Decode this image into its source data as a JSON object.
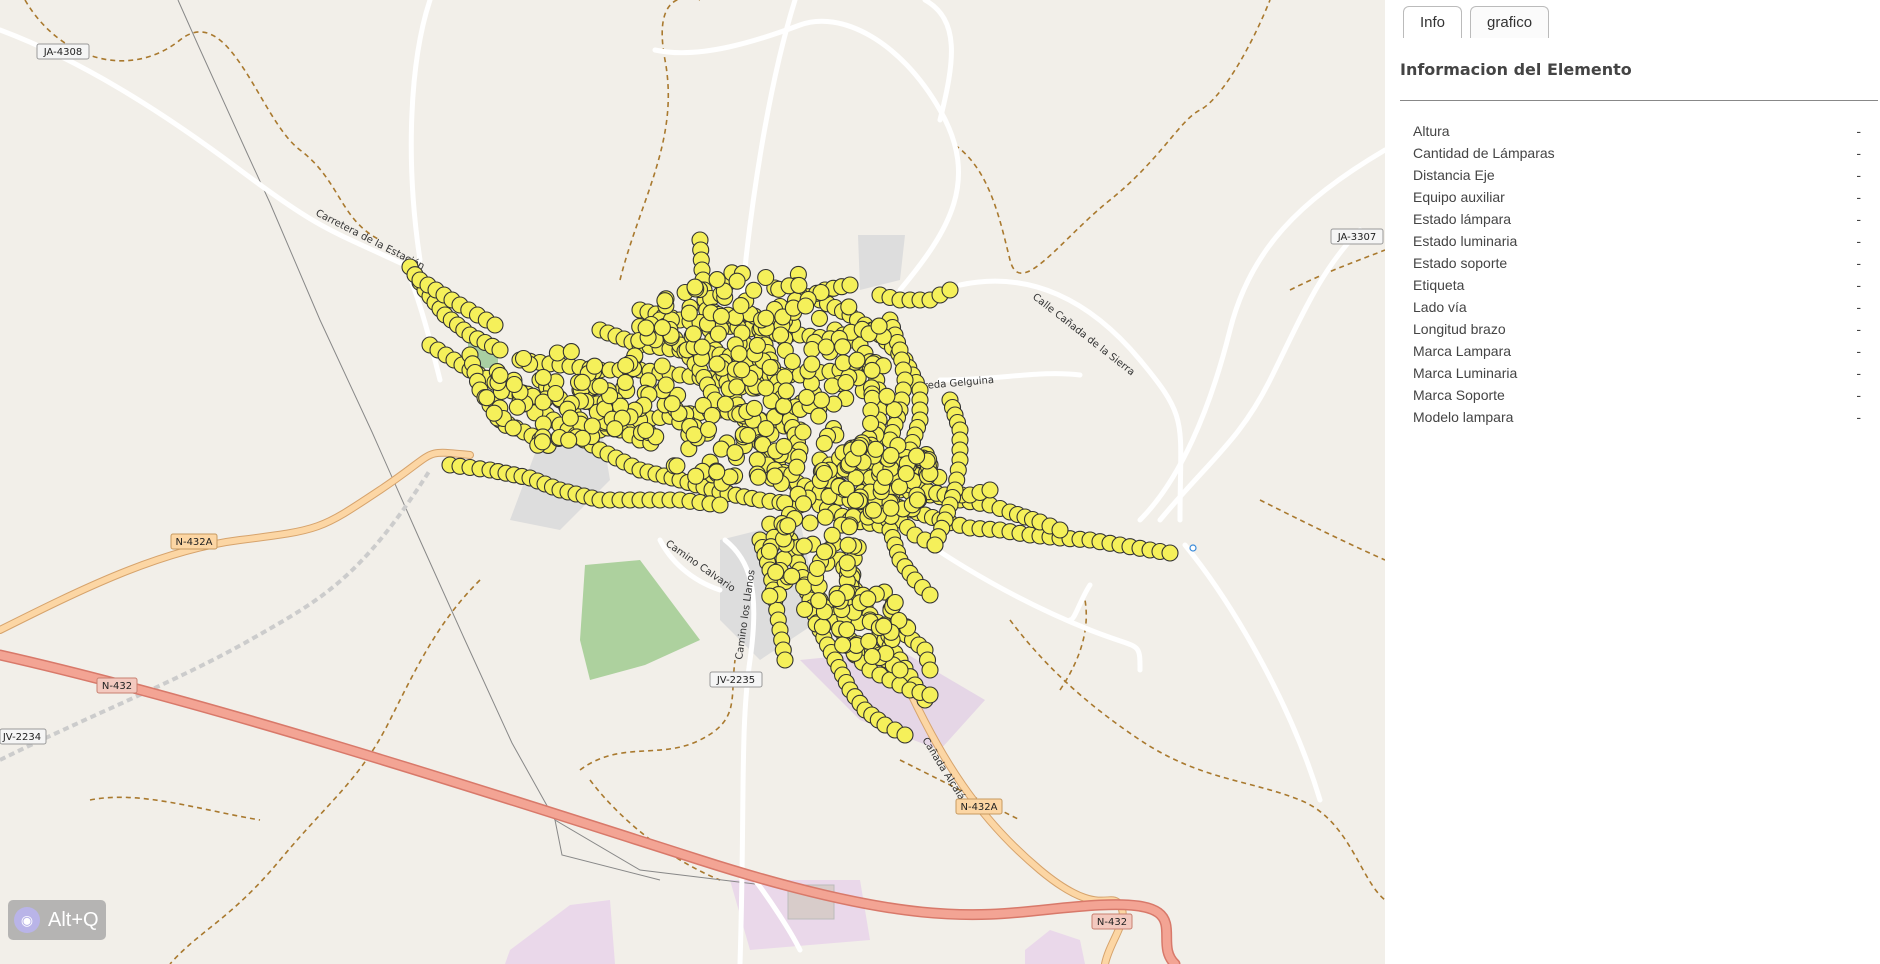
{
  "map": {
    "labels": {
      "ja4308": "JA-4308",
      "ja3307": "JA-3307",
      "n432a_left": "N-432A",
      "n432_left": "N-432",
      "jv2234": "JV-2234",
      "jv2235": "JV-2235",
      "n432a_bottom": "N-432A",
      "n432_bottom": "N-432",
      "carretera": "Carretera de la Estación",
      "calle_canada": "Calle Cañada de la Sierra",
      "vereda": "Vereda Gelguina",
      "camino_calvario": "Camino Calvario",
      "camino_llanos": "Camino los Llanos",
      "canada_alcala": "Cañada Alcalá"
    },
    "marker_style": {
      "fill": "#f5f05a",
      "stroke": "#333333"
    }
  },
  "shortcut": {
    "label": "Alt+Q",
    "icon": "eye-icon"
  },
  "panel": {
    "tabs": [
      {
        "label": "Info",
        "active": true
      },
      {
        "label": "grafico",
        "active": false
      }
    ],
    "title": "Informacion del Elemento",
    "attributes": [
      {
        "name": "Altura",
        "value": "-"
      },
      {
        "name": "Cantidad de Lámparas",
        "value": "-"
      },
      {
        "name": "Distancia Eje",
        "value": "-"
      },
      {
        "name": "Equipo auxiliar",
        "value": "-"
      },
      {
        "name": "Estado lámpara",
        "value": "-"
      },
      {
        "name": "Estado luminaria",
        "value": "-"
      },
      {
        "name": "Estado soporte",
        "value": "-"
      },
      {
        "name": "Etiqueta",
        "value": "-"
      },
      {
        "name": "Lado vía",
        "value": "-"
      },
      {
        "name": "Longitud brazo",
        "value": "-"
      },
      {
        "name": "Marca Lampara",
        "value": "-"
      },
      {
        "name": "Marca Luminaria",
        "value": "-"
      },
      {
        "name": "Marca Soporte",
        "value": "-"
      },
      {
        "name": "Modelo lampara",
        "value": "-"
      }
    ]
  }
}
